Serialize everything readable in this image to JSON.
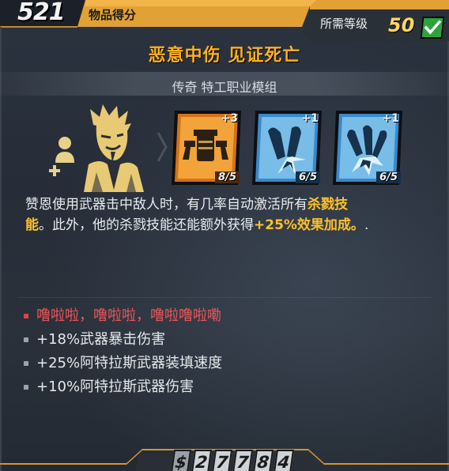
{
  "header": {
    "score": "521",
    "score_label": "物品得分",
    "required_level_label": "所需等级",
    "required_level": "50",
    "check_icon": "check-icon"
  },
  "item": {
    "title": "恶意中伤 见证死亡",
    "subtitle": "传奇 特工职业模组",
    "portrait_icon": "character-portrait-icon"
  },
  "skills": [
    {
      "icon": "twin-pistols-skill-icon",
      "bonus": "+3",
      "level": "8/5",
      "color": "#d4711a"
    },
    {
      "icon": "bullet-burst-skill-icon",
      "bonus": "+1",
      "level": "6/5",
      "color": "#3a89c9"
    },
    {
      "icon": "triple-bullet-skill-icon",
      "bonus": "+1",
      "level": "6/5",
      "color": "#3a89c9"
    }
  ],
  "description": {
    "p1": "赞恩使用武器击中敌人时，有几率自动激活所有",
    "hl1": "杀戮技",
    "p2": "能",
    "p3": "。此外，他的杀戮技能还能额外获得",
    "hl2": "+25%效果加成。",
    "p4": "."
  },
  "bullets": [
    {
      "text": "噜啦啦，噜啦啦，噜啦噜啦嘞",
      "color": "red"
    },
    {
      "text": "+18%武器暴击伤害",
      "color": "white"
    },
    {
      "text": "+25%阿特拉斯武器装填速度",
      "color": "white"
    },
    {
      "text": "+10%阿特拉斯武器伤害",
      "color": "white"
    }
  ],
  "price": {
    "currency": "$",
    "digits": [
      "2",
      "7",
      "7",
      "8",
      "4"
    ]
  },
  "colors": {
    "accent_orange": "#ffb01f",
    "legendary": "#e08a1e",
    "highlight": "#ffc12a",
    "red_text": "#ee5656"
  }
}
